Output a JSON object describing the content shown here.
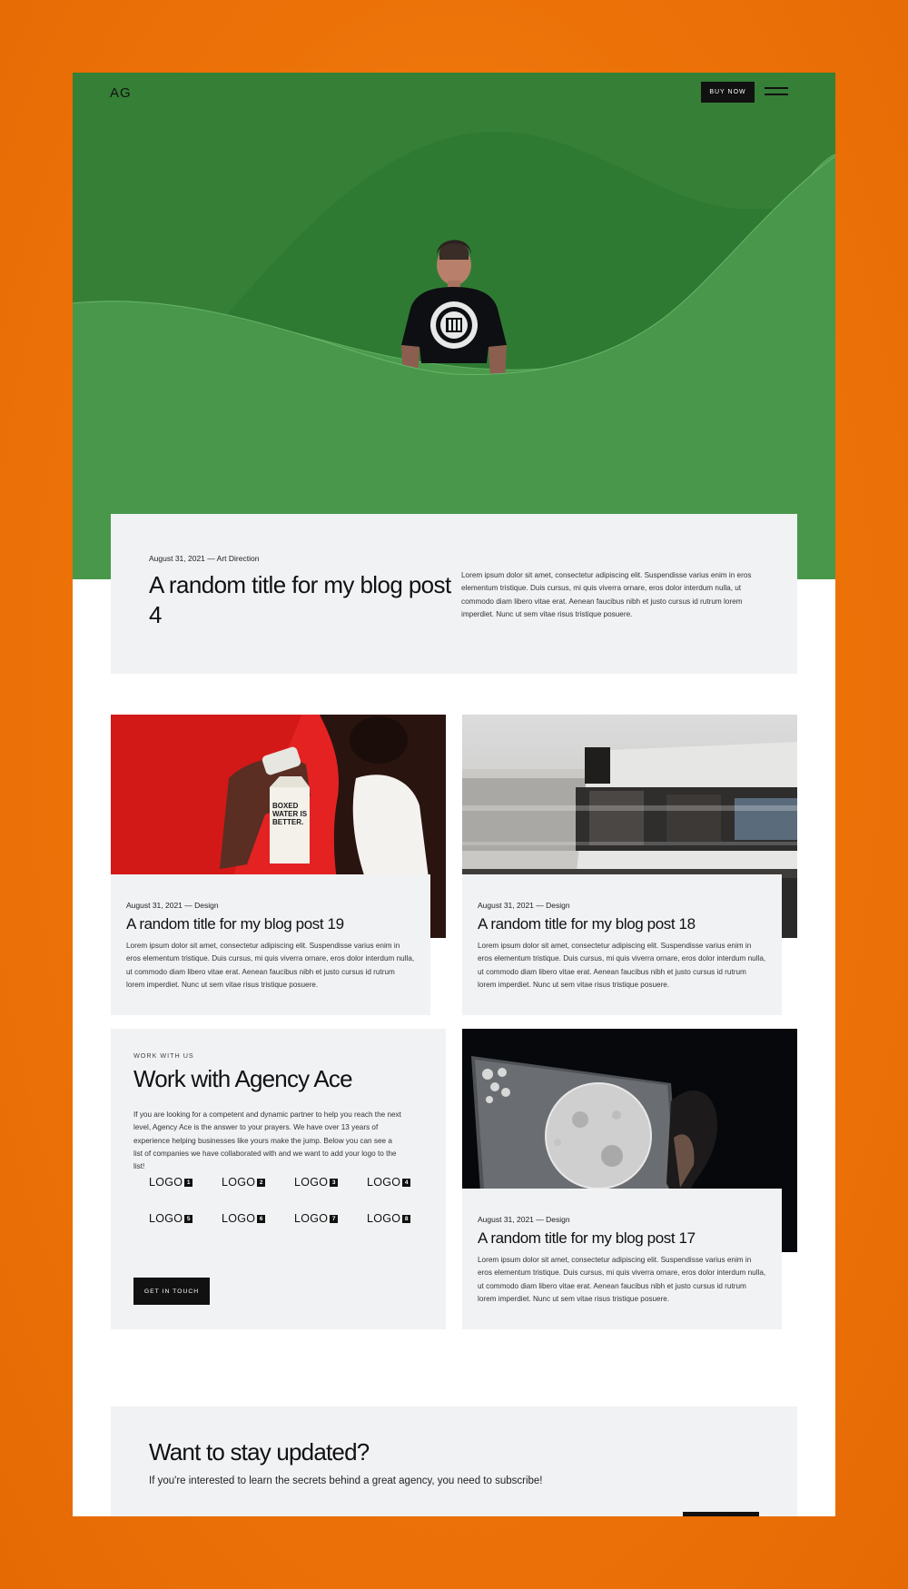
{
  "header": {
    "logo": "AG",
    "buy_label": "BUY NOW"
  },
  "featured": {
    "meta": "August 31, 2021 — Art Direction",
    "title": "A random title for my blog post 4",
    "excerpt": "Lorem ipsum dolor sit amet, consectetur adipiscing elit. Suspendisse varius enim in eros elementum tristique. Duis cursus, mi quis viverra ornare, eros dolor interdum nulla, ut commodo diam libero vitae erat. Aenean faucibus nibh et justo cursus id rutrum lorem imperdiet. Nunc ut sem vitae risus tristique posuere."
  },
  "posts": [
    {
      "meta": "August 31, 2021 — Design",
      "title": "A random title for my blog post 19",
      "excerpt": "Lorem ipsum dolor sit amet, consectetur adipiscing elit. Suspendisse varius enim in eros elementum tristique. Duis cursus, mi quis viverra ornare, eros dolor interdum nulla, ut commodo diam libero vitae erat. Aenean faucibus nibh et justo cursus id rutrum lorem imperdiet. Nunc ut sem vitae risus tristique posuere.",
      "carton_text": "BOXED WATER IS BETTER."
    },
    {
      "meta": "August 31, 2021 — Design",
      "title": "A random title for my blog post 18",
      "excerpt": "Lorem ipsum dolor sit amet, consectetur adipiscing elit. Suspendisse varius enim in eros elementum tristique. Duis cursus, mi quis viverra ornare, eros dolor interdum nulla, ut commodo diam libero vitae erat. Aenean faucibus nibh et justo cursus id rutrum lorem imperdiet. Nunc ut sem vitae risus tristique posuere."
    },
    {
      "meta": "August 31, 2021 — Design",
      "title": "A random title for my blog post 17",
      "excerpt": "Lorem ipsum dolor sit amet, consectetur adipiscing elit. Suspendisse varius enim in eros elementum tristique. Duis cursus, mi quis viverra ornare, eros dolor interdum nulla, ut commodo diam libero vitae erat. Aenean faucibus nibh et justo cursus id rutrum lorem imperdiet. Nunc ut sem vitae risus tristique posuere."
    }
  ],
  "work": {
    "eyebrow": "WORK WITH US",
    "title": "Work with Agency Ace",
    "body": "If you are looking for a competent and dynamic partner to help you reach the next level, Agency Ace is the answer to your prayers. We have over 13 years of experience helping businesses like yours make the jump. Below you can see a list of companies we have collaborated with and we want to add your logo to the list!",
    "logos": [
      {
        "label": "LOGO",
        "num": "1"
      },
      {
        "label": "LOGO",
        "num": "2"
      },
      {
        "label": "LOGO",
        "num": "3"
      },
      {
        "label": "LOGO",
        "num": "4"
      },
      {
        "label": "LOGO",
        "num": "5"
      },
      {
        "label": "LOGO",
        "num": "6"
      },
      {
        "label": "LOGO",
        "num": "7"
      },
      {
        "label": "LOGO",
        "num": "8"
      }
    ],
    "button_label": "GET IN TOUCH"
  },
  "newsletter": {
    "title": "Want to stay updated?",
    "subtitle": "If you're interested to learn the secrets behind a great agency, you need to subscribe!"
  },
  "colors": {
    "page_bg": "#ec7208",
    "hero_green": "#3c8a3e",
    "card_bg": "#f1f2f4",
    "button_bg": "#111111"
  }
}
